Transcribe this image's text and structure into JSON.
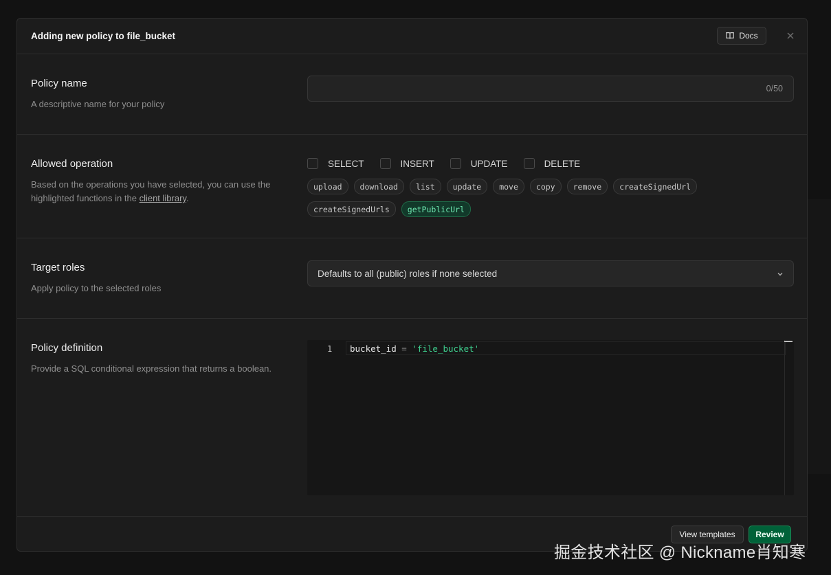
{
  "modal": {
    "title": "Adding new policy to file_bucket",
    "docs_label": "Docs"
  },
  "policy_name": {
    "title": "Policy name",
    "description": "A descriptive name for your policy",
    "value": "",
    "counter": "0/50"
  },
  "allowed_operation": {
    "title": "Allowed operation",
    "description_prefix": "Based on the operations you have selected, you can use the highlighted functions in the ",
    "description_link": "client library",
    "description_suffix": ".",
    "operations": [
      {
        "label": "SELECT",
        "checked": false
      },
      {
        "label": "INSERT",
        "checked": false
      },
      {
        "label": "UPDATE",
        "checked": false
      },
      {
        "label": "DELETE",
        "checked": false
      }
    ],
    "functions": [
      {
        "label": "upload",
        "highlighted": false
      },
      {
        "label": "download",
        "highlighted": false
      },
      {
        "label": "list",
        "highlighted": false
      },
      {
        "label": "update",
        "highlighted": false
      },
      {
        "label": "move",
        "highlighted": false
      },
      {
        "label": "copy",
        "highlighted": false
      },
      {
        "label": "remove",
        "highlighted": false
      },
      {
        "label": "createSignedUrl",
        "highlighted": false
      },
      {
        "label": "createSignedUrls",
        "highlighted": false
      },
      {
        "label": "getPublicUrl",
        "highlighted": true
      }
    ]
  },
  "target_roles": {
    "title": "Target roles",
    "description": "Apply policy to the selected roles",
    "select_value": "Defaults to all (public) roles if none selected"
  },
  "policy_definition": {
    "title": "Policy definition",
    "description": "Provide a SQL conditional expression that returns a boolean.",
    "line_number": "1",
    "code_identifier": "bucket_id",
    "code_operator": " = ",
    "code_string": "'file_bucket'"
  },
  "footer": {
    "view_templates_label": "View templates",
    "review_label": "Review"
  },
  "watermark": "掘金技术社区 @ Nickname肖知寒",
  "colors": {
    "background": "#1c1c1c",
    "accent_green": "#3ecf8e",
    "review_button": "#006239"
  }
}
